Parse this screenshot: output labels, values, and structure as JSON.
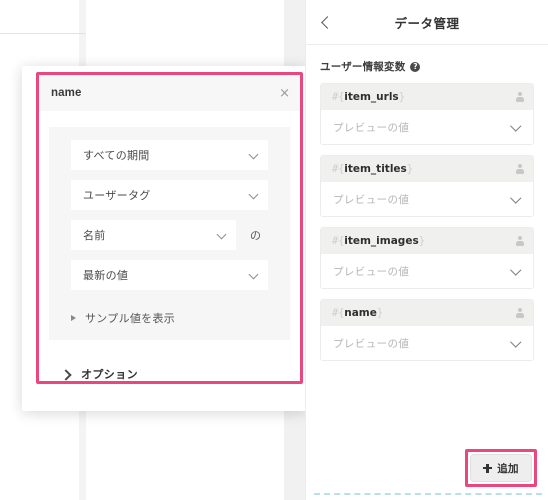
{
  "background": {
    "panel_note": ""
  },
  "dialog": {
    "title": "name",
    "close_icon": "close-icon",
    "close_label": "×",
    "fields": [
      {
        "label": "すべての期間",
        "suffix": ""
      },
      {
        "label": "ユーザータグ",
        "suffix": ""
      },
      {
        "label": "名前",
        "suffix": "の"
      },
      {
        "label": "最新の値",
        "suffix": ""
      }
    ],
    "sample_toggle": "サンプル値を表示",
    "options_toggle": "オプション",
    "highlight_color": "#e8487e"
  },
  "right_panel": {
    "header": {
      "back_icon": "chevron-left-icon",
      "title": "データ管理"
    },
    "section": {
      "label": "ユーザー情報変数",
      "help_icon": "help-icon",
      "help_glyph": "?"
    },
    "variables": [
      {
        "prefix": "#{",
        "name": "item_urls",
        "suffix": "}",
        "preview": "プレビューの値"
      },
      {
        "prefix": "#{",
        "name": "item_titles",
        "suffix": "}",
        "preview": "プレビューの値"
      },
      {
        "prefix": "#{",
        "name": "item_images",
        "suffix": "}",
        "preview": "プレビューの値"
      },
      {
        "prefix": "#{",
        "name": "name",
        "suffix": "}",
        "preview": "プレビューの値"
      }
    ],
    "add_button": {
      "label": "追加",
      "icon": "plus-icon",
      "highlight_color": "#e8487e"
    }
  }
}
